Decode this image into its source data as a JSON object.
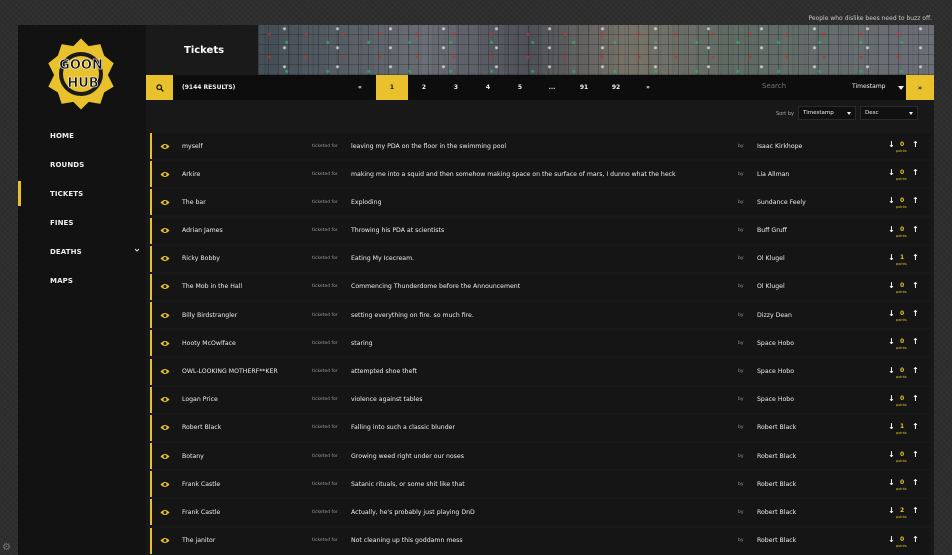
{
  "top_note": "People who dislike bees need to buzz off.",
  "brand": {
    "logo_text_1": "GOON",
    "logo_text_2": "HUB",
    "accent_color": "#e8c12d"
  },
  "sidebar": {
    "items": [
      {
        "label": "HOME",
        "active": false
      },
      {
        "label": "ROUNDS",
        "active": false
      },
      {
        "label": "TICKETS",
        "active": true
      },
      {
        "label": "FINES",
        "active": false
      },
      {
        "label": "DEATHS",
        "active": false,
        "has_submenu": true
      },
      {
        "label": "MAPS",
        "active": false
      }
    ]
  },
  "header": {
    "title": "Tickets"
  },
  "toolbar": {
    "search_icon": "search-icon",
    "results_text": "(9144 RESULTS)",
    "pages": [
      "«",
      "1",
      "2",
      "3",
      "4",
      "5",
      "...",
      "91",
      "92",
      "»"
    ],
    "current_page": "1",
    "search_placeholder": "Search",
    "search_field_option": "Timestamp",
    "go_label": "»"
  },
  "sort": {
    "label": "Sort by",
    "field": "Timestamp",
    "direction": "Desc"
  },
  "ticket_labels": {
    "ticketed_for": "ticketed for",
    "by": "by",
    "points": "points"
  },
  "tickets": [
    {
      "name": "myself",
      "reason": "leaving my PDA on the floor in the swimming pool",
      "admin": "Isaac Kirkhope",
      "points": "0"
    },
    {
      "name": "Arkire",
      "reason": "making me into a squid and then somehow making space on the surface of mars, I dunno what the heck",
      "admin": "Lia Allman",
      "points": "0"
    },
    {
      "name": "The bar",
      "reason": "Exploding",
      "admin": "Sundance Feely",
      "points": "0"
    },
    {
      "name": "Adrian James",
      "reason": "Throwing his PDA at scientists",
      "admin": "Buff Gruff",
      "points": "0"
    },
    {
      "name": "Ricky Bobby",
      "reason": "Eating My Icecream.",
      "admin": "Ol Klugel",
      "points": "1"
    },
    {
      "name": "The Mob in the Hall",
      "reason": "Commencing Thunderdome before the Announcement",
      "admin": "Ol Klugel",
      "points": "0"
    },
    {
      "name": "Billy Birdstrangler",
      "reason": "setting everything on fire. so much fire.",
      "admin": "Dizzy Dean",
      "points": "0"
    },
    {
      "name": "Hooty McOwlface",
      "reason": "staring",
      "admin": "Space Hobo",
      "points": "0"
    },
    {
      "name": "OWL-LOOKING MOTHERF**KER",
      "reason": "attempted shoe theft",
      "admin": "Space Hobo",
      "points": "0"
    },
    {
      "name": "Logan Price",
      "reason": "violence against tables",
      "admin": "Space Hobo",
      "points": "0"
    },
    {
      "name": "Robert Black",
      "reason": "Falling into such a classic blunder",
      "admin": "Robert Black",
      "points": "1"
    },
    {
      "name": "Botany",
      "reason": "Growing weed right under our noses",
      "admin": "Robert Black",
      "points": "0"
    },
    {
      "name": "Frank Castle",
      "reason": "Satanic rituals, or some shit like that",
      "admin": "Robert Black",
      "points": "0"
    },
    {
      "name": "Frank Castle",
      "reason": "Actually, he's probably just playing DnD",
      "admin": "Robert Black",
      "points": "2"
    },
    {
      "name": "The janitor",
      "reason": "Not cleaning up this goddamn mess",
      "admin": "Robert Black",
      "points": "0"
    }
  ]
}
